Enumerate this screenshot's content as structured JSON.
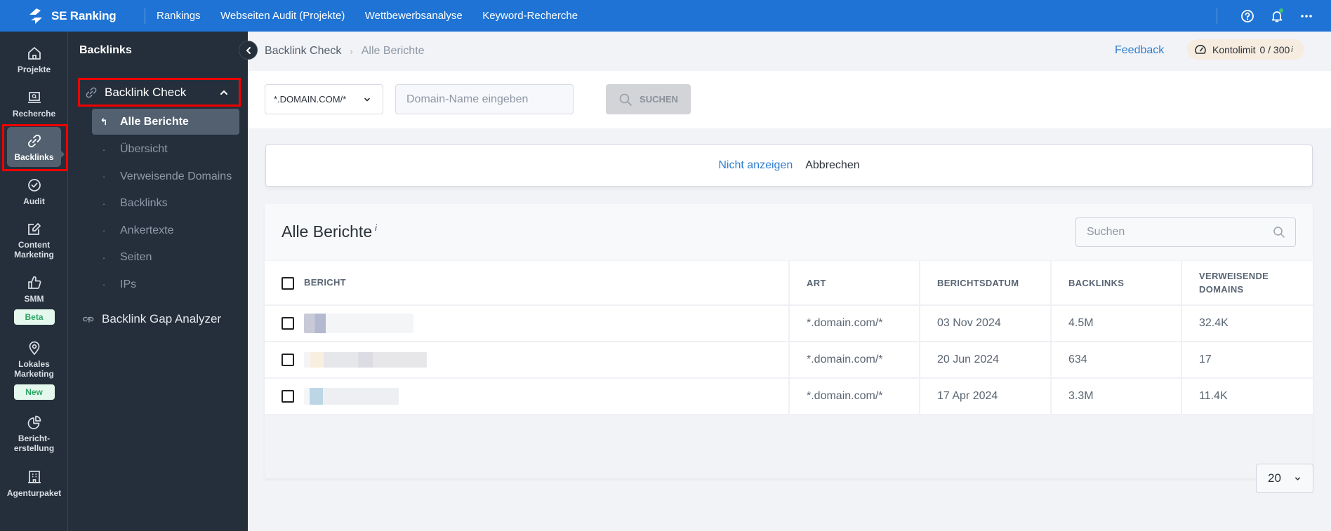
{
  "app": {
    "brand": "SE Ranking",
    "top_nav": [
      "Rankings",
      "Webseiten Audit (Projekte)",
      "Wettbewerbsanalyse",
      "Keyword-Recherche"
    ],
    "top_icons": [
      "help-icon",
      "notifications-icon",
      "more-icon"
    ]
  },
  "icon_sidebar": {
    "items": [
      {
        "label": "Projekte",
        "icon": "home-icon"
      },
      {
        "label": "Recherche",
        "icon": "research-icon"
      },
      {
        "label": "Backlinks",
        "icon": "link-icon",
        "active": true
      },
      {
        "label": "Audit",
        "icon": "check-circle-icon"
      },
      {
        "label": "Content Marketing",
        "icon": "edit-icon"
      },
      {
        "label": "SMM",
        "icon": "thumbs-up-icon",
        "badge": "Beta"
      },
      {
        "label": "Lokales Marketing",
        "icon": "location-pin-icon",
        "badge": "New"
      },
      {
        "label": "Bericht-erstellung",
        "icon": "pie-chart-icon"
      },
      {
        "label": "Agenturpaket",
        "icon": "building-icon"
      }
    ]
  },
  "sub_sidebar": {
    "title": "Backlinks",
    "group_label": "Backlink Check",
    "group_items": [
      {
        "label": "Alle Berichte",
        "active": true
      },
      {
        "label": "Übersicht"
      },
      {
        "label": "Verweisende Domains"
      },
      {
        "label": "Backlinks"
      },
      {
        "label": "Ankertexte"
      },
      {
        "label": "Seiten"
      },
      {
        "label": "IPs"
      }
    ],
    "other_item": "Backlink Gap Analyzer"
  },
  "header": {
    "breadcrumb": [
      "Backlink Check",
      "Alle Berichte"
    ],
    "feedback": "Feedback",
    "limit_label": "Kontolimit",
    "limit_value": "0 / 300",
    "info_mark": "i"
  },
  "search": {
    "type_value": "*.DOMAIN.COM/*",
    "domain_placeholder": "Domain-Name eingeben",
    "domain_value": "",
    "button_label": "SUCHEN"
  },
  "notice": {
    "hide_label": "Nicht anzeigen",
    "cancel_label": "Abbrechen"
  },
  "reports": {
    "title": "Alle Berichte",
    "info_mark": "i",
    "search_placeholder": "Suchen",
    "columns": [
      "BERICHT",
      "ART",
      "BERICHTSDATUM",
      "BACKLINKS",
      "VERWEISENDE DOMAINS"
    ],
    "rows": [
      {
        "report": "[blurred]",
        "type": "*.domain.com/*",
        "date": "03 Nov 2024",
        "backlinks": "4.5M",
        "domains": "32.4K"
      },
      {
        "report": "[blurred]",
        "type": "*.domain.com/*",
        "date": "20 Jun 2024",
        "backlinks": "634",
        "domains": "17"
      },
      {
        "report": "[blurred]",
        "type": "*.domain.com/*",
        "date": "17 Apr 2024",
        "backlinks": "3.3M",
        "domains": "11.4K"
      }
    ],
    "per_page": "20"
  },
  "colors": {
    "brand_blue": "#1e73d4",
    "sidebar_dark": "#252f3b",
    "active_item": "#52606f",
    "highlight_red": "#f00000",
    "link_blue": "#2f7fd0",
    "badge_green": "#2ca563"
  }
}
